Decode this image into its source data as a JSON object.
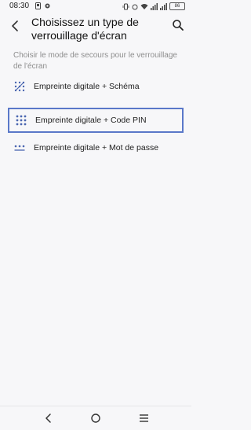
{
  "status_bar": {
    "time": "08:30",
    "battery": "86"
  },
  "header": {
    "title_line1": "Choisissez un type de",
    "title_line2": "verrouillage d'écran"
  },
  "description": "Choisir le mode de secours pour le verrouillage de l'écran",
  "options": [
    {
      "label": "Empreinte digitale + Schéma",
      "icon": "pattern-icon"
    },
    {
      "label": "Empreinte digitale + Code PIN",
      "icon": "pin-grid-icon"
    },
    {
      "label": "Empreinte digitale + Mot de passe",
      "icon": "password-icon"
    }
  ],
  "colors": {
    "accent": "#5a78c9",
    "icon": "#4a66b0",
    "secondary_text": "#8d8d8d"
  }
}
